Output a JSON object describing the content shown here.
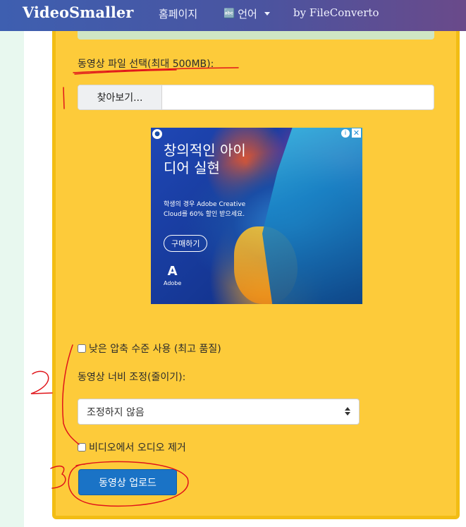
{
  "navbar": {
    "brand": "VideoSmaller",
    "home": "홈페이지",
    "language": "언어",
    "by": "by FileConverto"
  },
  "form": {
    "file_label": "동영상 파일 선택(최대 500MB):",
    "browse_label": "찾아보기...",
    "low_compression_label": "낮은 압축 수준 사용 (최고 품질)",
    "width_label": "동영상 너비 조정(줄이기):",
    "width_selected": "조정하지 않음",
    "remove_audio_label": "비디오에서 오디오 제거",
    "upload_label": "동영상 업로드"
  },
  "ad": {
    "title": "창의적인 아이디어 실현",
    "subtitle": "학생의 경우 Adobe Creative Cloud를 60% 할인 받으세요.",
    "cta": "구매하기",
    "brand": "Adobe"
  },
  "colors": {
    "panel": "#fdcb3a",
    "upload_button": "#1a73c6",
    "annotation": "#e0141a"
  }
}
